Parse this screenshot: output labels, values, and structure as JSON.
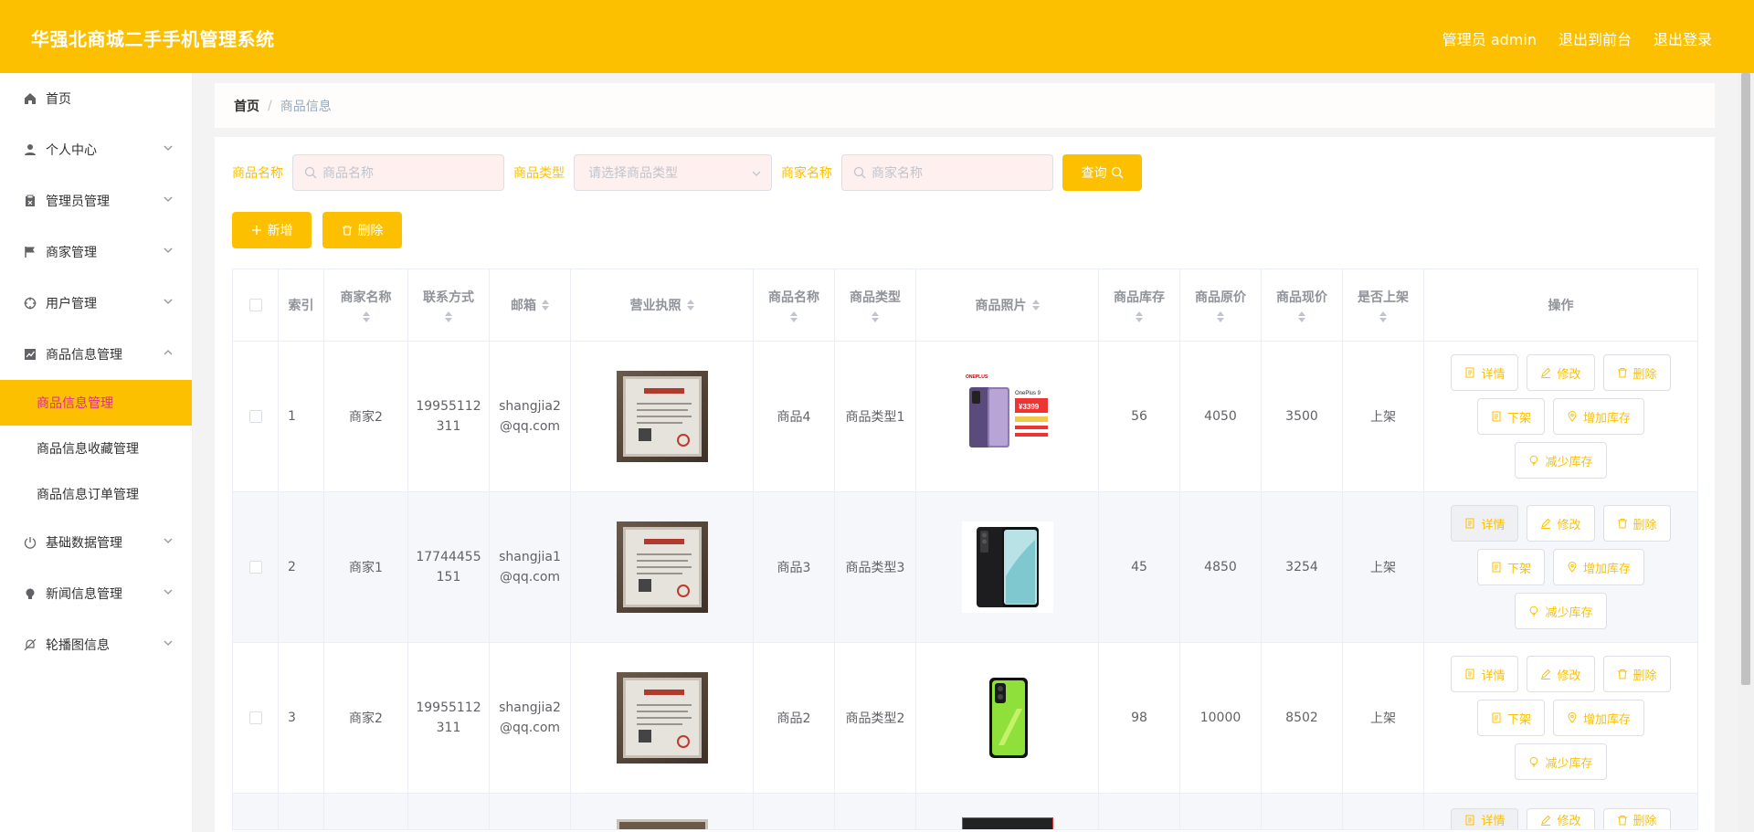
{
  "header": {
    "title": "华强北商城二手手机管理系统",
    "admin_label": "管理员 admin",
    "front_link": "退出到前台",
    "logout_link": "退出登录"
  },
  "sidebar": {
    "items": [
      {
        "label": "首页",
        "icon": "home-icon"
      },
      {
        "label": "个人中心",
        "icon": "user-icon"
      },
      {
        "label": "管理员管理",
        "icon": "clipboard-icon"
      },
      {
        "label": "商家管理",
        "icon": "flag-icon"
      },
      {
        "label": "用户管理",
        "icon": "target-icon"
      },
      {
        "label": "商品信息管理",
        "icon": "chart-icon"
      },
      {
        "label": "基础数据管理",
        "icon": "power-icon"
      },
      {
        "label": "新闻信息管理",
        "icon": "bulb-icon"
      },
      {
        "label": "轮播图信息",
        "icon": "bell-off-icon"
      }
    ],
    "sub_items": [
      {
        "label": "商品信息管理",
        "active": true
      },
      {
        "label": "商品信息收藏管理",
        "active": false
      },
      {
        "label": "商品信息订单管理",
        "active": false
      }
    ],
    "active_color": "#fdc000"
  },
  "breadcrumb": {
    "home": "首页",
    "separator": "/",
    "current": "商品信息"
  },
  "search": {
    "name_label": "商品名称",
    "name_placeholder": "商品名称",
    "type_label": "商品类型",
    "type_placeholder": "请选择商品类型",
    "shop_label": "商家名称",
    "shop_placeholder": "商家名称",
    "query_button": "查询"
  },
  "actions": {
    "add": "新增",
    "delete": "删除"
  },
  "table": {
    "headers": {
      "index": "索引",
      "shop": "商家名称",
      "phone": "联系方式",
      "email": "邮箱",
      "license": "营业执照",
      "goods_name": "商品名称",
      "goods_type": "商品类型",
      "photo": "商品照片",
      "stock": "商品库存",
      "orig_price": "商品原价",
      "cur_price": "商品现价",
      "on_shelf": "是否上架",
      "ops": "操作"
    },
    "rows": [
      {
        "index": "1",
        "shop": "商家2",
        "phone_a": "19955112",
        "phone_b": "311",
        "email_a": "shangjia2",
        "email_b": "@qq.com",
        "goods_name": "商品4",
        "goods_type": "商品类型1",
        "stock": "56",
        "orig_price": "4050",
        "cur_price": "3500",
        "on_shelf": "上架"
      },
      {
        "index": "2",
        "shop": "商家1",
        "phone_a": "17744455",
        "phone_b": "151",
        "email_a": "shangjia1",
        "email_b": "@qq.com",
        "goods_name": "商品3",
        "goods_type": "商品类型3",
        "stock": "45",
        "orig_price": "4850",
        "cur_price": "3254",
        "on_shelf": "上架"
      },
      {
        "index": "3",
        "shop": "商家2",
        "phone_a": "19955112",
        "phone_b": "311",
        "email_a": "shangjia2",
        "email_b": "@qq.com",
        "goods_name": "商品2",
        "goods_type": "商品类型2",
        "stock": "98",
        "orig_price": "10000",
        "cur_price": "8502",
        "on_shelf": "上架"
      }
    ],
    "op_labels": {
      "detail": "详情",
      "edit": "修改",
      "delete": "删除",
      "off_shelf": "下架",
      "add_stock": "增加库存",
      "reduce_stock": "减少库存"
    },
    "photo_texts": {
      "brand": "ONEPLUS",
      "model": "OnePlus 9",
      "price": "¥3399"
    }
  }
}
